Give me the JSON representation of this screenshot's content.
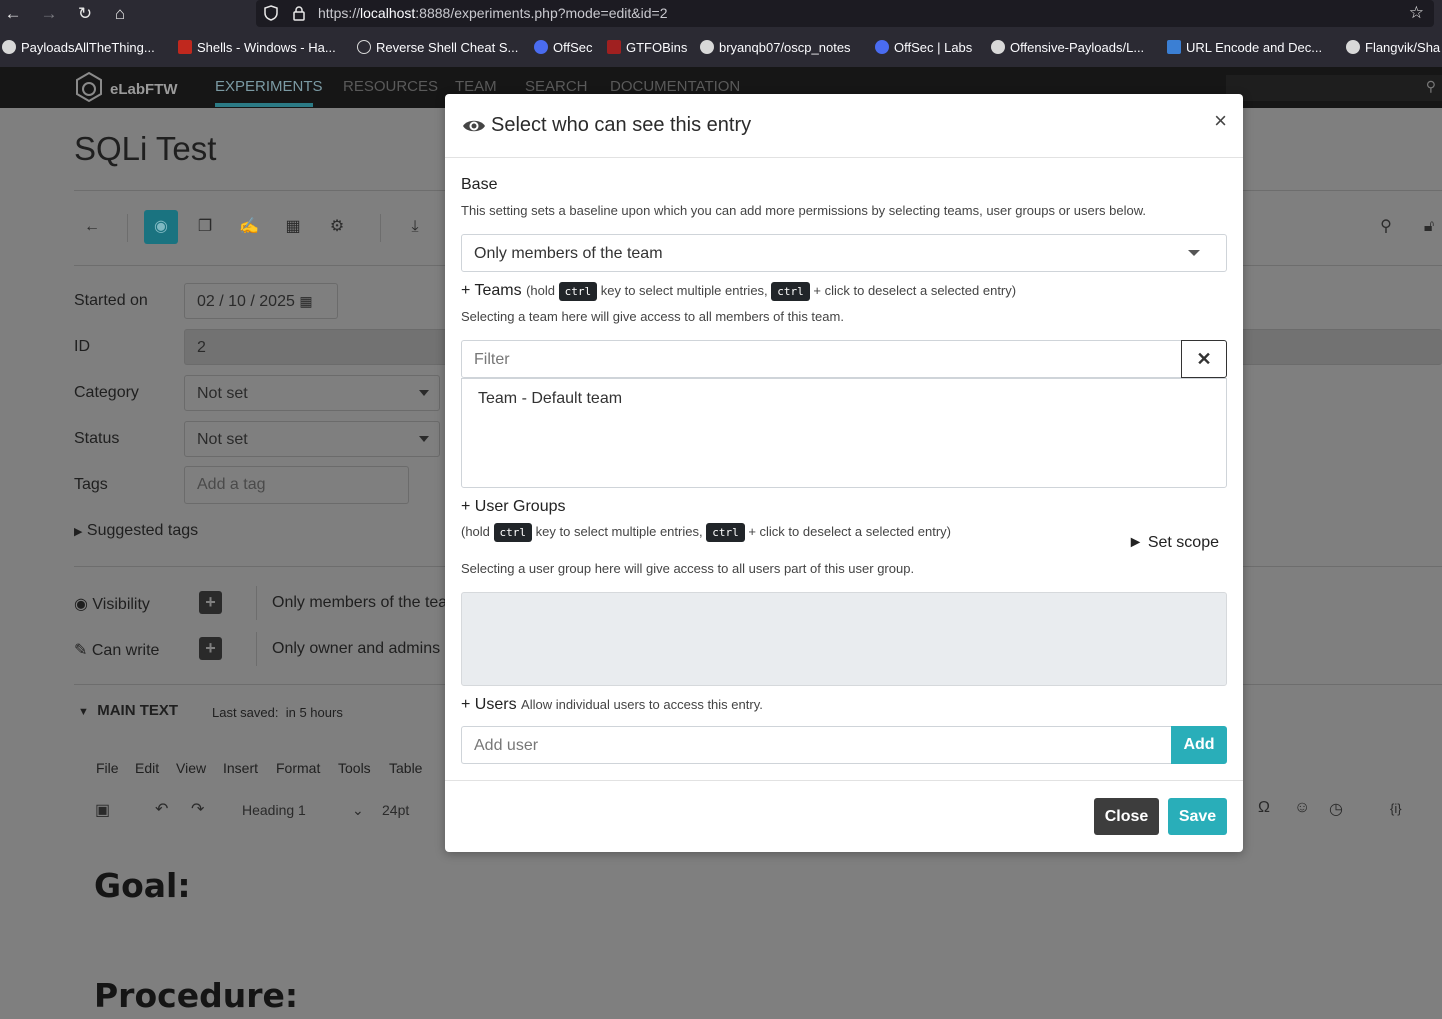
{
  "browser": {
    "url_prefix": "https://",
    "url_host": "localhost",
    "url_rest": ":8888/experiments.php?mode=edit&id=2",
    "bookmarks": [
      "PayloadsAllTheThing...",
      "Shells - Windows - Ha...",
      "Reverse Shell Cheat S...",
      "OffSec",
      "GTFOBins",
      "bryanqb07/oscp_notes",
      "OffSec | Labs",
      "Offensive-Payloads/L...",
      "URL Encode and Dec...",
      "Flangvik/Sha"
    ]
  },
  "app": {
    "brand": "eLabFTW",
    "nav": [
      "EXPERIMENTS",
      "RESOURCES",
      "TEAM",
      "SEARCH",
      "DOCUMENTATION"
    ]
  },
  "page": {
    "title": "SQLi Test",
    "started_on_label": "Started on",
    "started_on_value": "02 / 10 / 2025",
    "id_label": "ID",
    "id_value": "2",
    "category_label": "Category",
    "category_value": "Not set",
    "status_label": "Status",
    "status_value": "Not set",
    "tags_label": "Tags",
    "tags_placeholder": "Add a tag",
    "suggested_tags": "Suggested tags",
    "visibility_label": "Visibility",
    "visibility_value": "Only members of the tea",
    "can_write_label": "Can write",
    "can_write_value": "Only owner and admins",
    "main_text_label": "MAIN TEXT",
    "last_saved_label": "Last saved:",
    "last_saved_value": "in 5 hours",
    "editor_menu": [
      "File",
      "Edit",
      "View",
      "Insert",
      "Format",
      "Tools",
      "Table"
    ],
    "block_format": "Heading 1",
    "font_size": "24pt",
    "heading_goal": "Goal:",
    "heading_procedure": "Procedure:"
  },
  "modal": {
    "title": "Select who can see this entry",
    "base_label": "Base",
    "base_help": "This setting sets a baseline upon which you can add more permissions by selecting teams, user groups or users below.",
    "base_value": "Only members of the team",
    "teams_label": "+ Teams",
    "hold": "(hold",
    "kbd": "ctrl",
    "multi_text": "key to select multiple entries,",
    "deselect_text": "+ click to deselect a selected entry)",
    "teams_help": "Selecting a team here will give access to all members of this team.",
    "filter_placeholder": "Filter",
    "team_option": "Team - Default team",
    "user_groups_label": "+ User Groups",
    "set_scope": "► Set scope",
    "groups_help": "Selecting a user group here will give access to all users part of this user group.",
    "users_label": "+ Users",
    "users_help": "Allow individual users to access this entry.",
    "add_user_placeholder": "Add user",
    "add_button": "Add",
    "close_button": "Close",
    "save_button": "Save",
    "close_x": "×"
  }
}
